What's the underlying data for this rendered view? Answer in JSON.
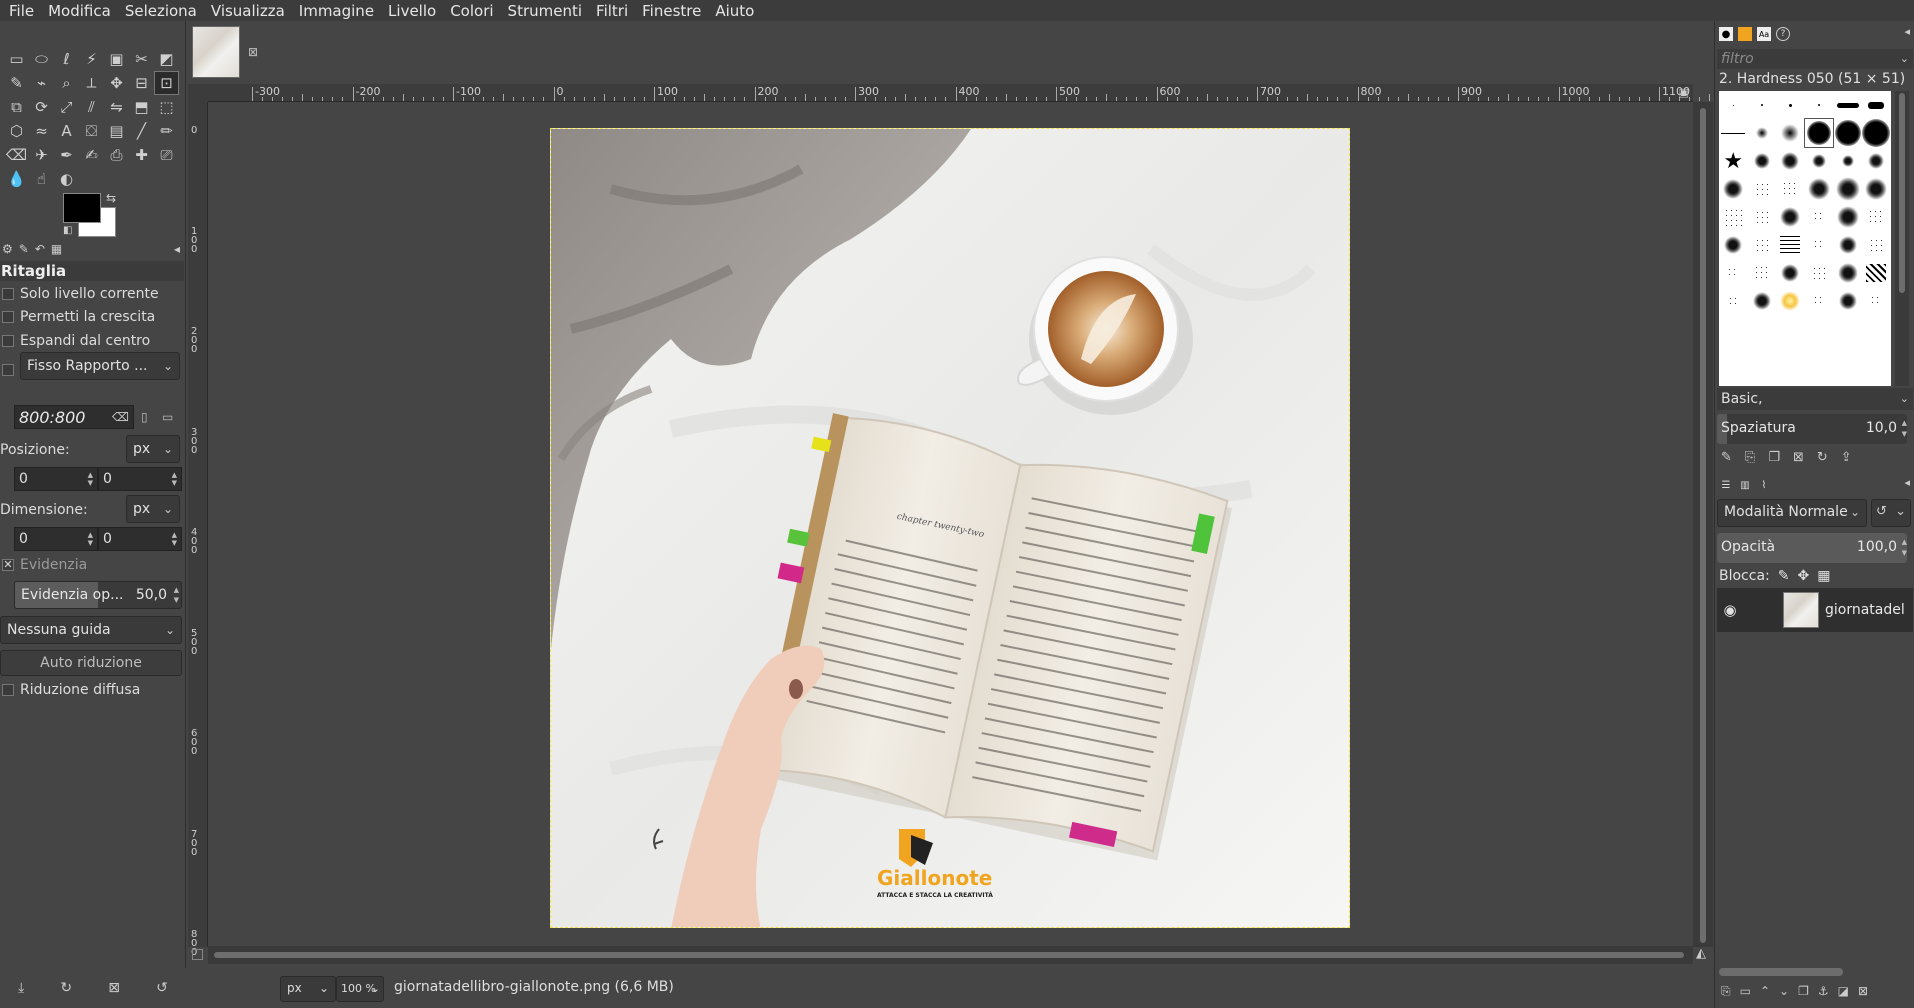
{
  "menu": [
    "File",
    "Modifica",
    "Seleziona",
    "Visualizza",
    "Immagine",
    "Livello",
    "Colori",
    "Strumenti",
    "Filtri",
    "Finestre",
    "Aiuto"
  ],
  "colors": {
    "foreground": "#000000",
    "background": "#ffffff",
    "selection_border": "#f3e14a"
  },
  "toolbox": {
    "tool_icons": [
      "rect-select-icon",
      "ellipse-select-icon",
      "free-select-icon",
      "fuzzy-select-icon",
      "by-color-select-icon",
      "scissors-icon",
      "foreground-select-icon",
      "paths-icon",
      "color-picker-icon",
      "zoom-icon",
      "measure-icon",
      "move-icon",
      "align-icon",
      "crop-icon",
      "unified-transform-icon",
      "rotate-icon",
      "scale-icon",
      "shear-icon",
      "flip-icon",
      "perspective-icon",
      "3d-transform-icon",
      "cage-icon",
      "warp-icon",
      "text-icon",
      "bucket-fill-icon",
      "gradient-icon",
      "paintbrush-icon",
      "pencil-icon",
      "eraser-icon",
      "airbrush-icon",
      "ink-icon",
      "mypaint-icon",
      "clone-icon",
      "heal-icon",
      "perspective-clone-icon",
      "blur-icon",
      "smudge-icon",
      "dodge-burn-icon"
    ],
    "active_tool": "crop-icon"
  },
  "tool_options": {
    "title": "Ritaglia",
    "current_layer_only": "Solo livello corrente",
    "allow_growing": "Permetti la crescita",
    "expand_from_center": "Espandi dal centro",
    "fixed_combo": "Fisso Rapporto ...",
    "ratio_value": "800:800",
    "position_label": "Posizione:",
    "position_unit": "px",
    "position_x": "0",
    "position_y": "0",
    "size_label": "Dimensione:",
    "size_unit": "px",
    "size_w": "0",
    "size_h": "0",
    "highlight_label": "Evidenzia",
    "highlight_opacity_label": "Evidenzia op...",
    "highlight_opacity_value": "50,0",
    "guides_combo": "Nessuna guida",
    "auto_shrink_button": "Auto riduzione",
    "shrink_merged": "Riduzione diffusa"
  },
  "ruler": {
    "h_labels": [
      "-300",
      "-200",
      "-100",
      "0",
      "100",
      "200",
      "300",
      "400",
      "500",
      "600",
      "700",
      "800",
      "900",
      "1000",
      "1100"
    ],
    "v_labels": [
      "0",
      "100",
      "200",
      "300",
      "400",
      "500",
      "600",
      "700",
      "800"
    ]
  },
  "status": {
    "unit": "px",
    "zoom": "100 %",
    "file_info": "giornatadellibro-giallonote.png (6,6 MB)"
  },
  "photo": {
    "logo_text": "Giallonote",
    "logo_tagline": "ATTACCA E STACCA LA CREATIVITÀ",
    "book_chapter": "chapter twenty-two"
  },
  "brushes": {
    "filter_placeholder": "filtro",
    "current_brush": "2. Hardness 050 (51 × 51)",
    "tag_combo": "Basic,",
    "spacing_label": "Spaziatura",
    "spacing_value": "10,0"
  },
  "layers": {
    "mode": "Modalità Normale",
    "opacity_label": "Opacità",
    "opacity_value": "100,0",
    "lock_label": "Blocca:",
    "layer_name": "giornatadellibro-giallonote.png"
  }
}
